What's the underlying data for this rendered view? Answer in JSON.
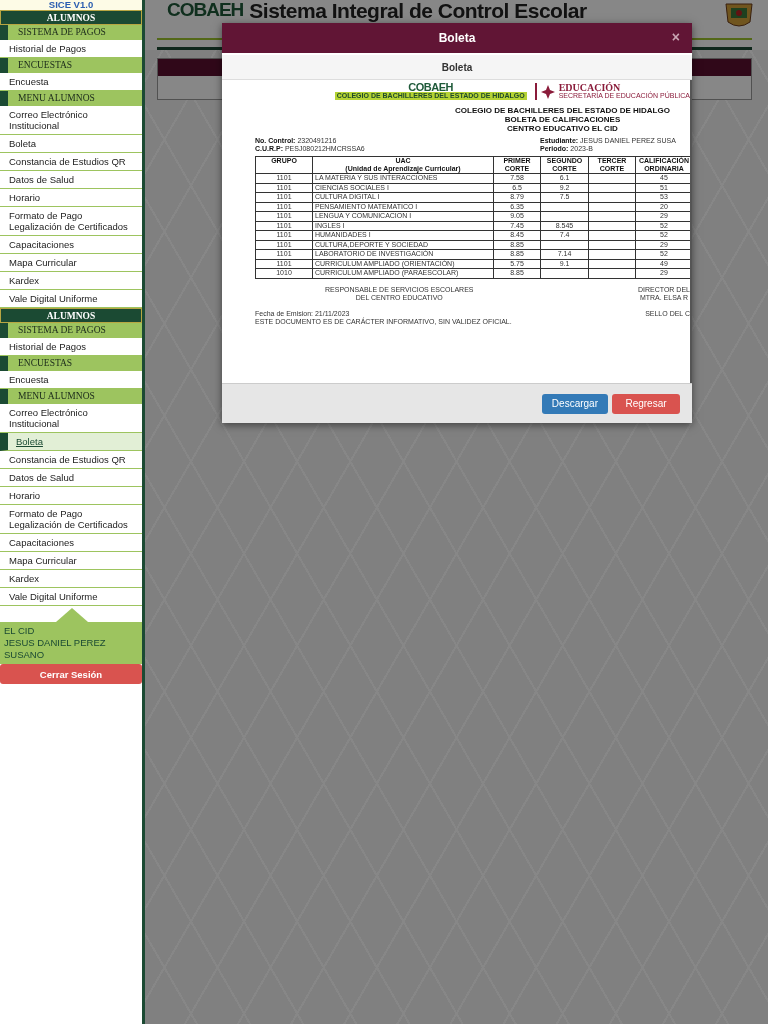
{
  "sidebar": {
    "version": "SICE V1.0",
    "menus": [
      {
        "items": [
          {
            "kind": "header",
            "label": "ALUMNOS"
          },
          {
            "kind": "section",
            "label": "SISTEMA DE PAGOS"
          },
          {
            "kind": "link",
            "label": "Historial de Pagos",
            "selected": false
          },
          {
            "kind": "section",
            "label": "ENCUESTAS"
          },
          {
            "kind": "link",
            "label": "Encuesta",
            "selected": false
          },
          {
            "kind": "section",
            "label": "MENU ALUMNOS"
          },
          {
            "kind": "link",
            "label": "Correo Electrónico Institucional",
            "selected": false
          },
          {
            "kind": "link",
            "label": "Boleta",
            "selected": false
          },
          {
            "kind": "link",
            "label": "Constancia de Estudios QR",
            "selected": false
          },
          {
            "kind": "link",
            "label": "Datos de Salud",
            "selected": false
          },
          {
            "kind": "link",
            "label": "Horario",
            "selected": false
          },
          {
            "kind": "link",
            "label": "Formato de Pago Legalización de Certificados",
            "selected": false
          },
          {
            "kind": "link",
            "label": "Capacitaciones",
            "selected": false
          },
          {
            "kind": "link",
            "label": "Mapa Curricular",
            "selected": false
          },
          {
            "kind": "link",
            "label": "Kardex",
            "selected": false
          },
          {
            "kind": "link",
            "label": "Vale Digital Uniforme",
            "selected": false
          }
        ]
      },
      {
        "items": [
          {
            "kind": "header",
            "label": "ALUMNOS"
          },
          {
            "kind": "section",
            "label": "SISTEMA DE PAGOS"
          },
          {
            "kind": "link",
            "label": "Historial de Pagos",
            "selected": false
          },
          {
            "kind": "section",
            "label": "ENCUESTAS"
          },
          {
            "kind": "link",
            "label": "Encuesta",
            "selected": false
          },
          {
            "kind": "section",
            "label": "MENU ALUMNOS"
          },
          {
            "kind": "link",
            "label": "Correo Electrónico Institucional",
            "selected": false
          },
          {
            "kind": "link",
            "label": "Boleta",
            "selected": true
          },
          {
            "kind": "link",
            "label": "Constancia de Estudios QR",
            "selected": false
          },
          {
            "kind": "link",
            "label": "Datos de Salud",
            "selected": false
          },
          {
            "kind": "link",
            "label": "Horario",
            "selected": false
          },
          {
            "kind": "link",
            "label": "Formato de Pago Legalización de Certificados",
            "selected": false
          },
          {
            "kind": "link",
            "label": "Capacitaciones",
            "selected": false
          },
          {
            "kind": "link",
            "label": "Mapa Curricular",
            "selected": false
          },
          {
            "kind": "link",
            "label": "Kardex",
            "selected": false
          },
          {
            "kind": "link",
            "label": "Vale Digital Uniforme",
            "selected": false
          }
        ]
      }
    ],
    "user": {
      "lines": [
        "EL CID",
        "JESUS DANIEL PEREZ SUSANO"
      ]
    },
    "logout_button": "Cerrar Sesión"
  },
  "header": {
    "logo": "COBAEH",
    "title": "Sistema Integral de Control Escolar"
  },
  "modal": {
    "title": "Boleta",
    "close": "×",
    "subtitle": "Boleta",
    "document": {
      "logo": "COBAEH",
      "logo_caption": "COLEGIO DE BACHILLERES DEL ESTADO DE HIDALGO",
      "agency": "EDUCACIÓN",
      "agency_caption": "SECRETARÍA DE EDUCACIÓN PÚBLICA",
      "heading": [
        "COLEGIO DE BACHILLERES DEL ESTADO DE HIDALGO",
        "BOLETA DE CALIFICACIONES",
        "CENTRO EDUCATIVO EL CID"
      ],
      "info_left": [
        {
          "label": "No. Control:",
          "value": "2320491216"
        },
        {
          "label": "C.U.R.P:",
          "value": "PESJ080212HMCRSSA6"
        }
      ],
      "info_right": [
        {
          "label": "Estudiante:",
          "value": "JESUS DANIEL PEREZ SUSA"
        },
        {
          "label": "Periodo:",
          "value": "2023-B"
        }
      ],
      "table": {
        "columns": [
          "GRUPO",
          "UAC\n(Unidad de Aprendizaje Curricular)",
          "PRIMER\nCORTE",
          "SEGUNDO\nCORTE",
          "TERCER\nCORTE",
          "CALIFICACIÓN\nORDINARIA"
        ],
        "rows": [
          [
            "1101",
            "LA MATERIA Y SUS INTERACCIONES",
            "7.58",
            "6.1",
            "",
            "45"
          ],
          [
            "1101",
            "CIENCIAS SOCIALES I",
            "6.5",
            "9.2",
            "",
            "51"
          ],
          [
            "1101",
            "CULTURA DIGITAL I",
            "8.79",
            "7.5",
            "",
            "53"
          ],
          [
            "1101",
            "PENSAMIENTO MATEMATICO I",
            "6.35",
            "",
            "",
            "20"
          ],
          [
            "1101",
            "LENGUA Y COMUNICACION I",
            "9.05",
            "",
            "",
            "29"
          ],
          [
            "1101",
            "INGLES I",
            "7.45",
            "8.545",
            "",
            "52"
          ],
          [
            "1101",
            "HUMANIDADES I",
            "8.45",
            "7.4",
            "",
            "52"
          ],
          [
            "1101",
            "CULTURA,DEPORTE Y SOCIEDAD",
            "8.85",
            "",
            "",
            "29"
          ],
          [
            "1101",
            "LABORATORIO DE INVESTIGACIÓN",
            "8.85",
            "7.14",
            "",
            "52"
          ],
          [
            "1101",
            "CURRICULUM AMPLIADO (ORIENTACIÓN)",
            "5.75",
            "9.1",
            "",
            "49"
          ],
          [
            "1010",
            "CURRICULUM AMPLIADO (PARAESCOLAR)",
            "8.85",
            "",
            "",
            "29"
          ]
        ]
      },
      "signature_left": [
        "RESPONSABLE DE SERVICIOS ESCOLARES",
        "DEL CENTRO EDUCATIVO"
      ],
      "signature_right": [
        "DIRECTOR DEL",
        "MTRA. ELSA R"
      ],
      "issue_date": "Fecha de Emision: 21/11/2023",
      "disclaimer": "ESTE DOCUMENTO ES DE CARÁCTER INFORMATIVO, SIN VALIDEZ OFICIAL.",
      "stamp": "SELLO DEL C"
    },
    "buttons": [
      {
        "kind": "primary",
        "label": "Descargar"
      },
      {
        "kind": "danger",
        "label": "Regresar"
      }
    ]
  }
}
